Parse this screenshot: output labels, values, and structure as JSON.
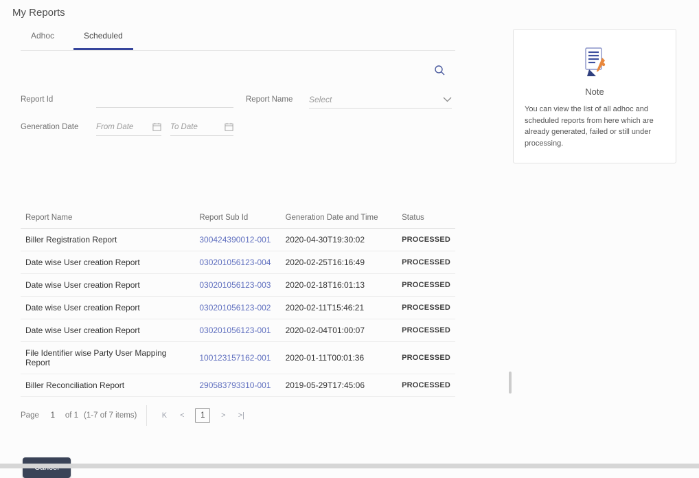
{
  "page": {
    "title": "My Reports"
  },
  "tabs": {
    "adhoc": "Adhoc",
    "scheduled": "Scheduled"
  },
  "filters": {
    "report_id": {
      "label": "Report Id",
      "value": ""
    },
    "report_name": {
      "label": "Report Name",
      "selected": "Select"
    },
    "generation_date": {
      "label": "Generation Date",
      "from_placeholder": "From Date",
      "to_placeholder": "To Date"
    }
  },
  "table": {
    "columns": [
      "Report Name",
      "Report Sub Id",
      "Generation Date and Time",
      "Status"
    ],
    "rows": [
      {
        "name": "Biller Registration Report",
        "sub_id": "300424390012-001",
        "generated": "2020-04-30T19:30:02",
        "status": "PROCESSED"
      },
      {
        "name": "Date wise User creation Report",
        "sub_id": "030201056123-004",
        "generated": "2020-02-25T16:16:49",
        "status": "PROCESSED"
      },
      {
        "name": "Date wise User creation Report",
        "sub_id": "030201056123-003",
        "generated": "2020-02-18T16:01:13",
        "status": "PROCESSED"
      },
      {
        "name": "Date wise User creation Report",
        "sub_id": "030201056123-002",
        "generated": "2020-02-11T15:46:21",
        "status": "PROCESSED"
      },
      {
        "name": "Date wise User creation Report",
        "sub_id": "030201056123-001",
        "generated": "2020-02-04T01:00:07",
        "status": "PROCESSED"
      },
      {
        "name": "File Identifier wise Party User Mapping Report",
        "sub_id": "100123157162-001",
        "generated": "2020-01-11T00:01:36",
        "status": "PROCESSED"
      },
      {
        "name": "Biller Reconciliation Report",
        "sub_id": "290583793310-001",
        "generated": "2019-05-29T17:45:06",
        "status": "PROCESSED"
      }
    ]
  },
  "pagination": {
    "page_label": "Page",
    "current_page": "1",
    "of_text": "of 1",
    "range_text": "(1-7 of 7 items)",
    "icons": {
      "first": "K",
      "prev": "<",
      "next": ">",
      "last": ">|"
    }
  },
  "actions": {
    "cancel": "Cancel"
  },
  "note": {
    "title": "Note",
    "body": "You can view the list of all adhoc and scheduled reports from here which are already generated, failed or still under processing."
  },
  "colors": {
    "accent": "#36459c",
    "link": "#5f6fbf",
    "cancel_bg": "#3a4357"
  }
}
